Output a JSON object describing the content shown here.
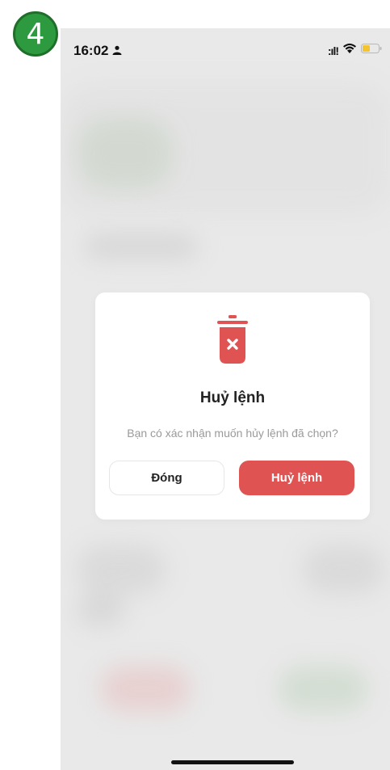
{
  "step_badge": "4",
  "status_bar": {
    "time": "16:02",
    "signal": ":ıl!"
  },
  "dialog": {
    "title": "Huỷ lệnh",
    "message": "Bạn có xác nhận muốn hủy lệnh đã chọn?",
    "close_label": "Đóng",
    "confirm_label": "Huỷ lệnh"
  },
  "colors": {
    "accent_red": "#e05353",
    "badge_green": "#2e9a3f",
    "overlay_gray": "#e9e9e9"
  }
}
